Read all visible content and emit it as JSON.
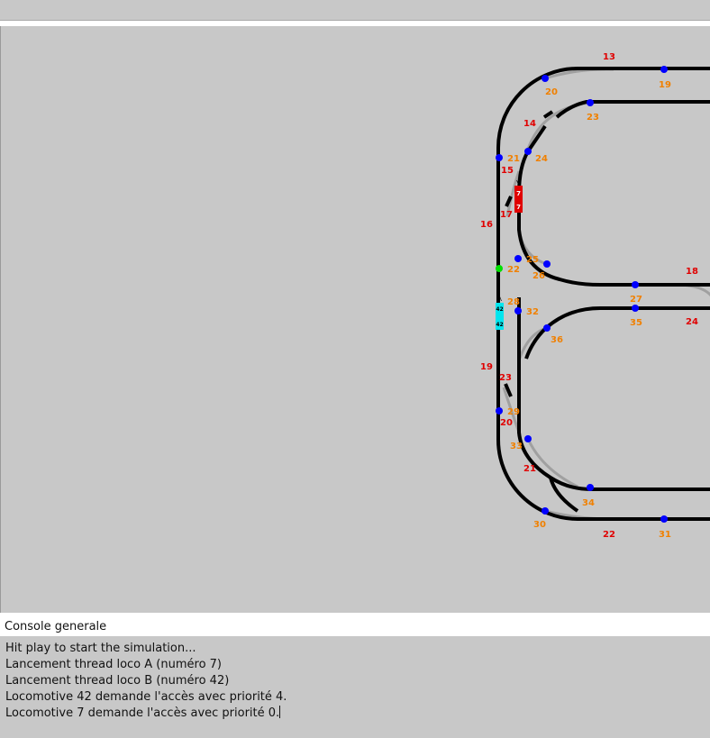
{
  "colors": {
    "background": "#c8c8c8",
    "track": "#000000",
    "switch_branch": "#a0a0a0",
    "section_label": "#e00000",
    "node_label": "#f08000",
    "node": "#0000ff",
    "node_free": "#00e000",
    "loco_a": "#e00000",
    "loco_b": "#00e5ee"
  },
  "layout": {
    "section_labels": [
      "13",
      "14",
      "15",
      "16",
      "17",
      "18",
      "19",
      "20",
      "21",
      "22",
      "23",
      "24"
    ],
    "node_labels": [
      "19",
      "20",
      "21",
      "22",
      "23",
      "24",
      "25",
      "26",
      "27",
      "28",
      "29",
      "30",
      "31",
      "32",
      "33",
      "34",
      "35",
      "36"
    ]
  },
  "locomotives": [
    {
      "name": "A",
      "number": "7",
      "color": "red"
    },
    {
      "name": "B",
      "number": "42",
      "color": "cyan"
    }
  ],
  "console": {
    "title": "Console generale",
    "lines": [
      "Hit play to start the simulation...",
      "Lancement thread loco A (numéro 7)",
      "Lancement thread loco B (numéro 42)",
      "Locomotive 42 demande l'accès avec priorité 4.",
      "Locomotive 7 demande l'accès avec priorité 0."
    ]
  }
}
